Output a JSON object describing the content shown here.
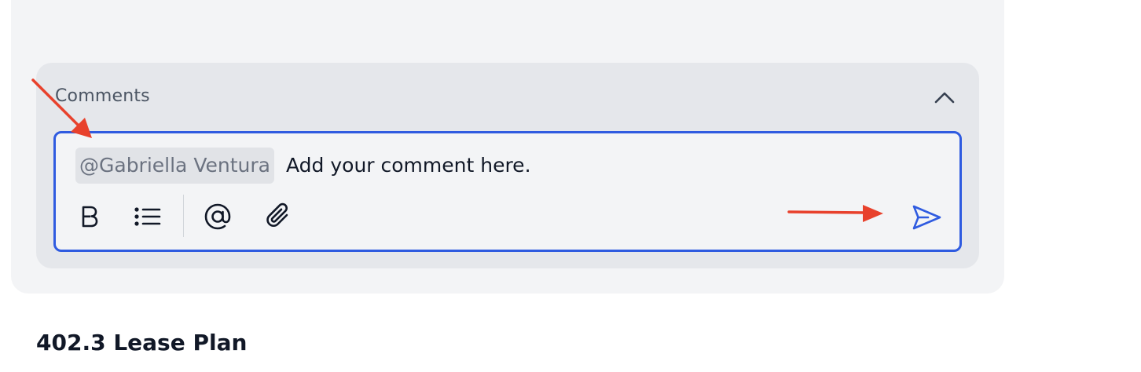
{
  "comments": {
    "title": "Comments",
    "collapse_icon": "chevron-up-icon",
    "editor": {
      "mention": "@Gabriella Ventura",
      "placeholder_text": "Add your comment here.",
      "toolbar": [
        {
          "name": "bold",
          "icon": "bold-icon"
        },
        {
          "name": "bulleted-list",
          "icon": "bullet-list-icon"
        },
        {
          "name": "mention",
          "icon": "at-sign-icon"
        },
        {
          "name": "attach",
          "icon": "paperclip-icon"
        }
      ],
      "send_icon": "send-icon"
    }
  },
  "next_section": {
    "heading": "402.3 Lease Plan"
  },
  "colors": {
    "accent": "#2f5be0",
    "annotation_arrow": "#e8412c",
    "panel_bg": "#e5e7eb",
    "card_bg": "#f3f4f6"
  }
}
